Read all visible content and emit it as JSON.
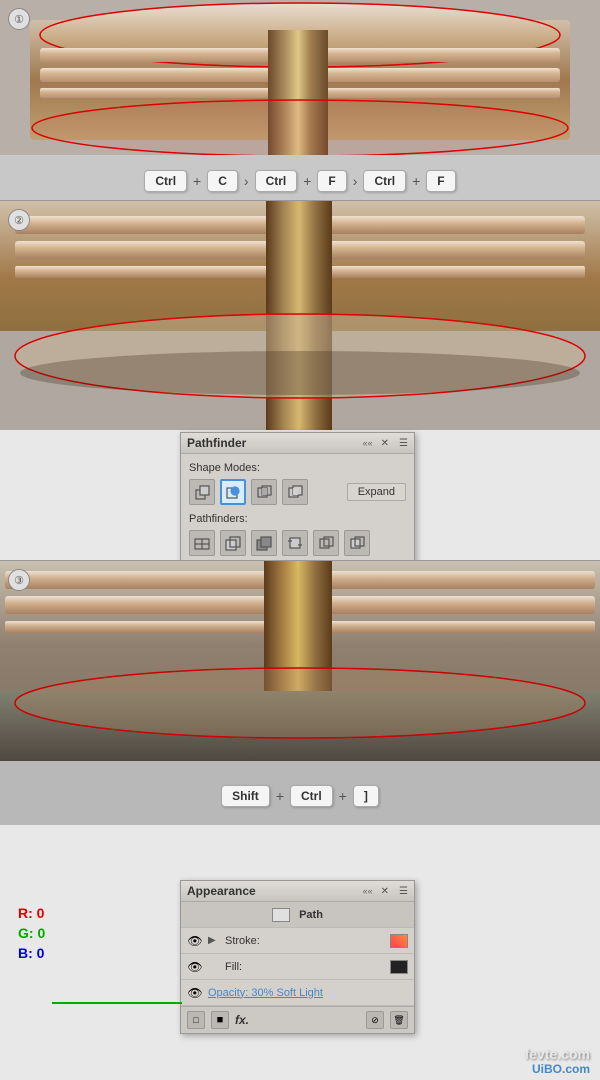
{
  "step1": {
    "number": "①",
    "shortcuts": [
      {
        "key": "Ctrl",
        "type": "kbd"
      },
      {
        "key": "+",
        "type": "plus"
      },
      {
        "key": "C",
        "type": "kbd"
      },
      {
        "key": ">",
        "type": "gt"
      },
      {
        "key": "Ctrl",
        "type": "kbd"
      },
      {
        "key": "+",
        "type": "plus"
      },
      {
        "key": "F",
        "type": "kbd"
      },
      {
        "key": ">",
        "type": "gt"
      },
      {
        "key": "Ctrl",
        "type": "kbd"
      },
      {
        "key": "+",
        "type": "plus"
      },
      {
        "key": "F",
        "type": "kbd"
      }
    ]
  },
  "step2": {
    "number": "②"
  },
  "pathfinder": {
    "title": "Pathfinder",
    "shape_modes_label": "Shape Modes:",
    "pathfinders_label": "Pathfinders:",
    "expand_label": "Expand",
    "controls": "«« ✕",
    "menu_icon": "☰"
  },
  "step3": {
    "number": "③",
    "shortcuts": [
      {
        "key": "Shift",
        "type": "kbd"
      },
      {
        "key": "+",
        "type": "plus"
      },
      {
        "key": "Ctrl",
        "type": "kbd"
      },
      {
        "key": "+",
        "type": "plus"
      },
      {
        "key": "]",
        "type": "kbd"
      }
    ]
  },
  "appearance": {
    "title": "Appearance",
    "controls": "«« ✕",
    "menu_icon": "☰",
    "path_label": "Path",
    "stroke_label": "Stroke:",
    "fill_label": "Fill:",
    "opacity_label": "Opacity: 30% Soft Light"
  },
  "rgb": {
    "r_label": "R: 0",
    "g_label": "G: 0",
    "b_label": "B: 0"
  },
  "watermark": {
    "site1": "fevte.com",
    "site2": "UiBO.com"
  }
}
